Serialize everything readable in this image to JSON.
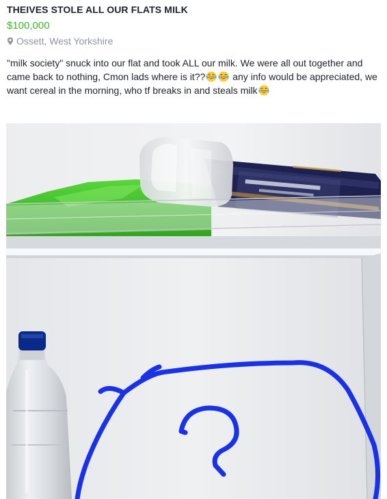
{
  "listing": {
    "title": "THEIVES STOLE ALL OUR FLATS MILK",
    "price": "$100,000",
    "location": "Ossett, West Yorkshire",
    "description": {
      "part1": "\"milk society\" snuck into our flat and took ALL our milk. We were all out together and came back to nothing, Cmon lads where is it??",
      "part2": " any info would be appreciated, we want cereal in the morning, who tf breaks in and steals milk"
    },
    "icons": {
      "location": "location-pin-icon",
      "emoji": "face-with-tears-of-joy-icon"
    },
    "colors": {
      "price": "#42b72a",
      "location": "#90949c",
      "scribble": "#1a32e6"
    }
  }
}
